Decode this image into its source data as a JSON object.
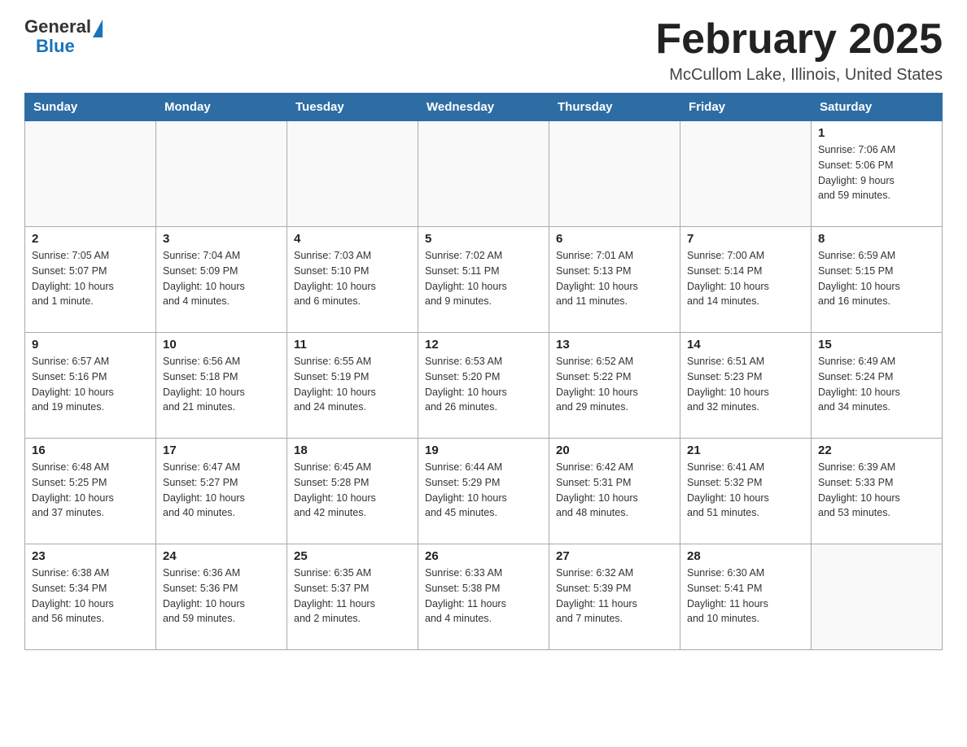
{
  "logo": {
    "general": "General",
    "blue": "Blue"
  },
  "header": {
    "month": "February 2025",
    "location": "McCullom Lake, Illinois, United States"
  },
  "weekdays": [
    "Sunday",
    "Monday",
    "Tuesday",
    "Wednesday",
    "Thursday",
    "Friday",
    "Saturday"
  ],
  "weeks": [
    [
      {
        "day": "",
        "info": ""
      },
      {
        "day": "",
        "info": ""
      },
      {
        "day": "",
        "info": ""
      },
      {
        "day": "",
        "info": ""
      },
      {
        "day": "",
        "info": ""
      },
      {
        "day": "",
        "info": ""
      },
      {
        "day": "1",
        "info": "Sunrise: 7:06 AM\nSunset: 5:06 PM\nDaylight: 9 hours\nand 59 minutes."
      }
    ],
    [
      {
        "day": "2",
        "info": "Sunrise: 7:05 AM\nSunset: 5:07 PM\nDaylight: 10 hours\nand 1 minute."
      },
      {
        "day": "3",
        "info": "Sunrise: 7:04 AM\nSunset: 5:09 PM\nDaylight: 10 hours\nand 4 minutes."
      },
      {
        "day": "4",
        "info": "Sunrise: 7:03 AM\nSunset: 5:10 PM\nDaylight: 10 hours\nand 6 minutes."
      },
      {
        "day": "5",
        "info": "Sunrise: 7:02 AM\nSunset: 5:11 PM\nDaylight: 10 hours\nand 9 minutes."
      },
      {
        "day": "6",
        "info": "Sunrise: 7:01 AM\nSunset: 5:13 PM\nDaylight: 10 hours\nand 11 minutes."
      },
      {
        "day": "7",
        "info": "Sunrise: 7:00 AM\nSunset: 5:14 PM\nDaylight: 10 hours\nand 14 minutes."
      },
      {
        "day": "8",
        "info": "Sunrise: 6:59 AM\nSunset: 5:15 PM\nDaylight: 10 hours\nand 16 minutes."
      }
    ],
    [
      {
        "day": "9",
        "info": "Sunrise: 6:57 AM\nSunset: 5:16 PM\nDaylight: 10 hours\nand 19 minutes."
      },
      {
        "day": "10",
        "info": "Sunrise: 6:56 AM\nSunset: 5:18 PM\nDaylight: 10 hours\nand 21 minutes."
      },
      {
        "day": "11",
        "info": "Sunrise: 6:55 AM\nSunset: 5:19 PM\nDaylight: 10 hours\nand 24 minutes."
      },
      {
        "day": "12",
        "info": "Sunrise: 6:53 AM\nSunset: 5:20 PM\nDaylight: 10 hours\nand 26 minutes."
      },
      {
        "day": "13",
        "info": "Sunrise: 6:52 AM\nSunset: 5:22 PM\nDaylight: 10 hours\nand 29 minutes."
      },
      {
        "day": "14",
        "info": "Sunrise: 6:51 AM\nSunset: 5:23 PM\nDaylight: 10 hours\nand 32 minutes."
      },
      {
        "day": "15",
        "info": "Sunrise: 6:49 AM\nSunset: 5:24 PM\nDaylight: 10 hours\nand 34 minutes."
      }
    ],
    [
      {
        "day": "16",
        "info": "Sunrise: 6:48 AM\nSunset: 5:25 PM\nDaylight: 10 hours\nand 37 minutes."
      },
      {
        "day": "17",
        "info": "Sunrise: 6:47 AM\nSunset: 5:27 PM\nDaylight: 10 hours\nand 40 minutes."
      },
      {
        "day": "18",
        "info": "Sunrise: 6:45 AM\nSunset: 5:28 PM\nDaylight: 10 hours\nand 42 minutes."
      },
      {
        "day": "19",
        "info": "Sunrise: 6:44 AM\nSunset: 5:29 PM\nDaylight: 10 hours\nand 45 minutes."
      },
      {
        "day": "20",
        "info": "Sunrise: 6:42 AM\nSunset: 5:31 PM\nDaylight: 10 hours\nand 48 minutes."
      },
      {
        "day": "21",
        "info": "Sunrise: 6:41 AM\nSunset: 5:32 PM\nDaylight: 10 hours\nand 51 minutes."
      },
      {
        "day": "22",
        "info": "Sunrise: 6:39 AM\nSunset: 5:33 PM\nDaylight: 10 hours\nand 53 minutes."
      }
    ],
    [
      {
        "day": "23",
        "info": "Sunrise: 6:38 AM\nSunset: 5:34 PM\nDaylight: 10 hours\nand 56 minutes."
      },
      {
        "day": "24",
        "info": "Sunrise: 6:36 AM\nSunset: 5:36 PM\nDaylight: 10 hours\nand 59 minutes."
      },
      {
        "day": "25",
        "info": "Sunrise: 6:35 AM\nSunset: 5:37 PM\nDaylight: 11 hours\nand 2 minutes."
      },
      {
        "day": "26",
        "info": "Sunrise: 6:33 AM\nSunset: 5:38 PM\nDaylight: 11 hours\nand 4 minutes."
      },
      {
        "day": "27",
        "info": "Sunrise: 6:32 AM\nSunset: 5:39 PM\nDaylight: 11 hours\nand 7 minutes."
      },
      {
        "day": "28",
        "info": "Sunrise: 6:30 AM\nSunset: 5:41 PM\nDaylight: 11 hours\nand 10 minutes."
      },
      {
        "day": "",
        "info": ""
      }
    ]
  ]
}
